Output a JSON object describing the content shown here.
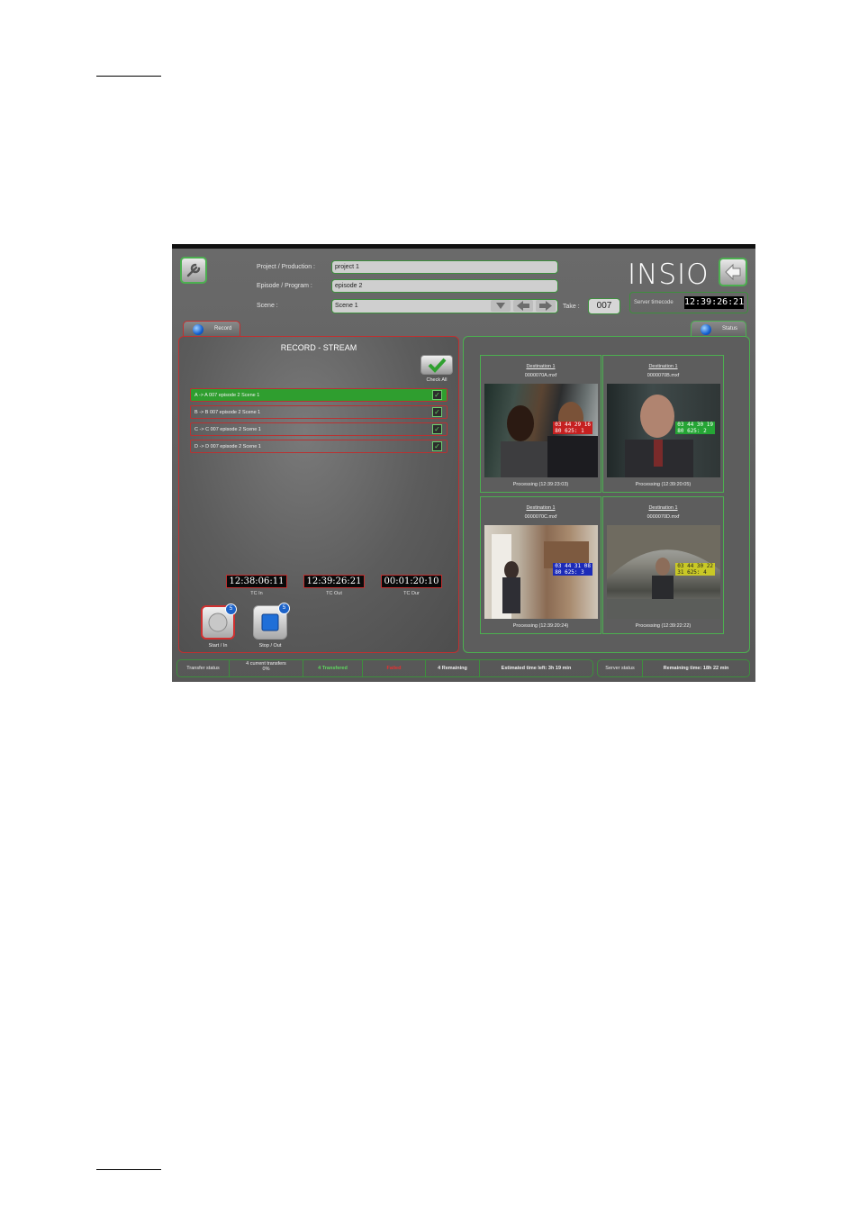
{
  "app": {
    "logo": "INSIO",
    "project_label": "Project / Production :",
    "project_value": "project 1",
    "episode_label": "Episode / Program :",
    "episode_value": "episode 2",
    "scene_label": "Scene :",
    "scene_value": "Scene 1",
    "take_label": "Take :",
    "take_value": "007",
    "server_timecode_label": "Server timecode",
    "server_timecode": "12:39:26:21",
    "record_tab": "Record",
    "status_tab": "Status",
    "record_title": "RECORD - STREAM",
    "check_all_label": "Check All",
    "streams": [
      {
        "label": "A -> A 007 episode 2 Scene 1"
      },
      {
        "label": "B -> B 007 episode 2 Scene 1"
      },
      {
        "label": "C -> C 007 episode 2 Scene 1"
      },
      {
        "label": "D -> D 007 episode 2 Scene 1"
      }
    ],
    "tc": [
      {
        "value": "12:38:06:11",
        "label": "TC In"
      },
      {
        "value": "12:39:26:21",
        "label": "TC Out"
      },
      {
        "value": "00:01:20:10",
        "label": "TC Dur"
      }
    ],
    "start_label": "Start / In",
    "start_badge": "5",
    "stop_label": "Stop / Out",
    "stop_badge": "5",
    "destinations": [
      {
        "title": "Destination 1",
        "file": "0000070A.mxf",
        "status": "Processing (12:39:23:03)",
        "ov1": "03 44 29 16",
        "ov2": "80 625:   1",
        "ov_color": "#c62020"
      },
      {
        "title": "Destination 1",
        "file": "0000070B.mxf",
        "status": "Processing (12:39:20:05)",
        "ov1": "03 44 30 19",
        "ov2": "80 625:   2",
        "ov_color": "#25a535"
      },
      {
        "title": "Destination 1",
        "file": "0000070C.mxf",
        "status": "Processing (12:39:20:24)",
        "ov1": "03 44 31 08",
        "ov2": "80 625:   3",
        "ov_color": "#1c2bb8"
      },
      {
        "title": "Destination 1",
        "file": "0000070D.mxf",
        "status": "Processing (12:39:22:22)",
        "ov1": "03 44 30 22",
        "ov2": "31 625:   4",
        "ov_color": "#c9c826"
      }
    ],
    "status_bar": {
      "transfer_status": "Transfer status",
      "current_transfers": "4 current transfers",
      "percent": "0%",
      "transferred": "4 Transfered",
      "failed": "Failed",
      "remaining": "4 Remaining",
      "estimated": "Estimated time left: 3h 19 min",
      "server_status": "Server status",
      "remaining_time": "Remaining time: 18h 22 min"
    }
  }
}
